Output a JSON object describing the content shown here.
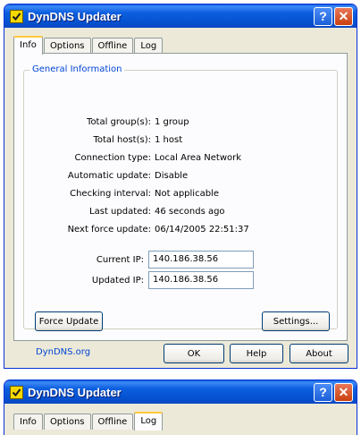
{
  "window_main": {
    "title": "DynDNS Updater",
    "help_glyph": "?",
    "close_glyph": "✕",
    "tabs": [
      {
        "label": "Info",
        "active": true
      },
      {
        "label": "Options",
        "active": false
      },
      {
        "label": "Offline",
        "active": false
      },
      {
        "label": "Log",
        "active": false
      }
    ],
    "group_title": "General Information",
    "info": [
      {
        "label": "Total group(s):",
        "value": "1 group"
      },
      {
        "label": "Total host(s):",
        "value": "1 host"
      },
      {
        "label": "Connection type:",
        "value": "Local Area Network"
      },
      {
        "label": "Automatic update:",
        "value": "Disable"
      },
      {
        "label": "Checking interval:",
        "value": "Not applicable"
      },
      {
        "label": "Last updated:",
        "value": "46 seconds ago"
      },
      {
        "label": "Next force update:",
        "value": "06/14/2005 22:51:37"
      }
    ],
    "current_ip_label": "Current IP:",
    "current_ip_value": "140.186.38.56",
    "updated_ip_label": "Updated IP:",
    "updated_ip_value": "140.186.38.56",
    "force_update_label": "Force Update",
    "settings_label": "Settings...",
    "link_label": "DynDNS.org",
    "ok_label": "OK",
    "help_label": "Help",
    "about_label": "About"
  },
  "window_second": {
    "title": "DynDNS Updater",
    "help_glyph": "?",
    "close_glyph": "✕",
    "tabs": [
      {
        "label": "Info",
        "active": false
      },
      {
        "label": "Options",
        "active": false
      },
      {
        "label": "Offline",
        "active": false
      },
      {
        "label": "Log",
        "active": true
      }
    ]
  },
  "colors": {
    "titlebar": "#0552d1",
    "accent_link": "#0046d5",
    "active_tab_highlight": "#ffc83c",
    "close_button": "#c9400f"
  },
  "icons": {
    "app": "checkbox-check-icon",
    "help": "question-mark-icon",
    "close": "close-x-icon"
  }
}
